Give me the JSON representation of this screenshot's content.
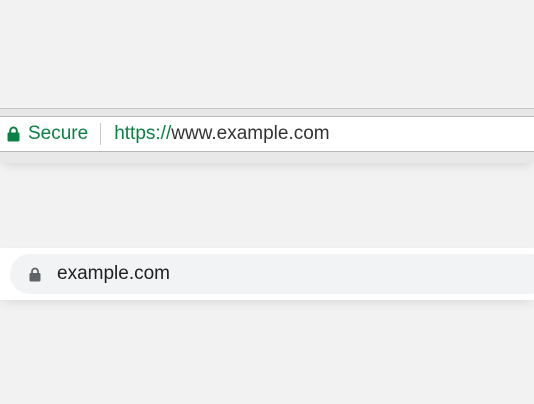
{
  "old_omnibox": {
    "secure_label": "Secure",
    "url_scheme": "https://",
    "url_host": "www.example.com",
    "lock_icon": "lock-icon",
    "secure_color": "#0b8043"
  },
  "new_omnibox": {
    "url": "example.com",
    "lock_icon": "lock-icon",
    "lock_color": "#5f6368"
  }
}
